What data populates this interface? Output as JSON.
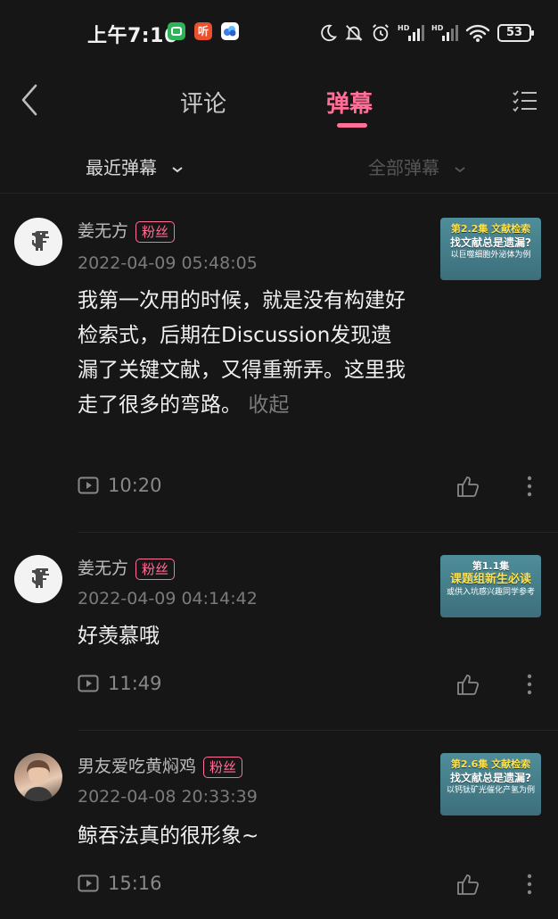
{
  "status_bar": {
    "time": "上午7:16",
    "app_icons": [
      {
        "name": "miui-app-icon",
        "label": "",
        "color": "#2fb35a"
      },
      {
        "name": "ting-app-icon",
        "label": "听",
        "color": "#e8502e"
      },
      {
        "name": "cloud-app-icon",
        "label": "",
        "color": "#3f7de8"
      }
    ],
    "battery": "53"
  },
  "nav": {
    "tabs": [
      {
        "label": "评论",
        "active": false
      },
      {
        "label": "弹幕",
        "active": true
      }
    ],
    "accent_color": "#ff6f97"
  },
  "filters": {
    "recent": "最近弹幕",
    "all": "全部弹幕"
  },
  "comments": [
    {
      "username": "姜无方",
      "badge": "粉丝",
      "date": "2022-04-09 05:48:05",
      "text": "我第一次用的时候，就是没有构建好检索式，后期在Discussion发现遗漏了关键文献，又得重新弄。这里我走了很多的弯路。",
      "collapse": "收起",
      "timecode": "10:20",
      "avatar": "dino-avatar",
      "thumb": {
        "line1": "第2.2集 文献检索",
        "line2": "找文献总是遗漏?",
        "line3": "以巨噬细胞外泌体为例"
      }
    },
    {
      "username": "姜无方",
      "badge": "粉丝",
      "date": "2022-04-09 04:14:42",
      "text": "好羡慕哦",
      "timecode": "11:49",
      "avatar": "dino-avatar",
      "thumb": {
        "line1": "第1.1集",
        "line2": "课题组新生必读",
        "line3": "或供入坑感兴趣同学参考"
      }
    },
    {
      "username": "男友爱吃黄焖鸡",
      "badge": "粉丝",
      "date": "2022-04-08 20:33:39",
      "text": "鲸吞法真的很形象~",
      "timecode": "15:16",
      "avatar": "photo-avatar",
      "thumb": {
        "line1": "第2.6集 文献检索",
        "line2": "找文献总是遗漏?",
        "line3": "以钙钛矿光催化产氢为例"
      }
    }
  ]
}
